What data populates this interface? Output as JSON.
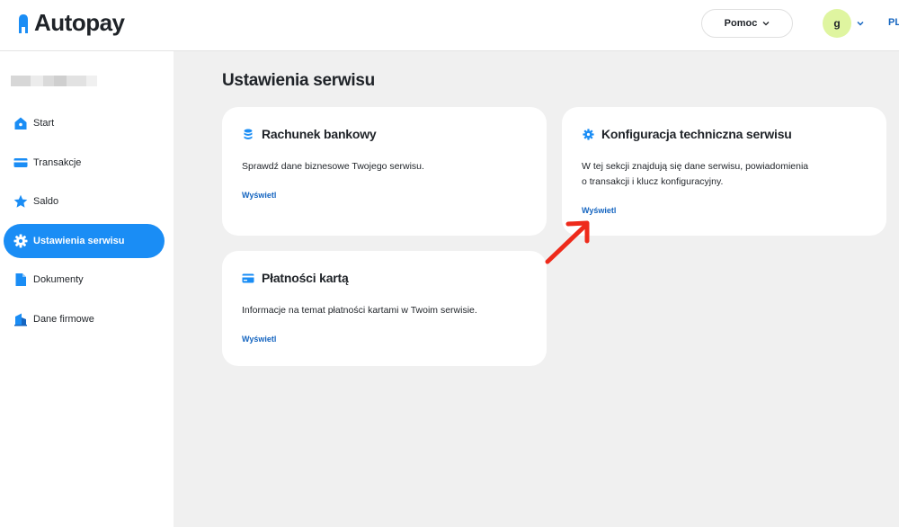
{
  "header": {
    "logo_text": "Autopay",
    "help_label": "Pomoc",
    "avatar_initial": "g",
    "language": "PL"
  },
  "sidebar": {
    "items": [
      {
        "label": "Start",
        "icon": "home-icon"
      },
      {
        "label": "Transakcje",
        "icon": "card-icon"
      },
      {
        "label": "Saldo",
        "icon": "star-icon"
      },
      {
        "label": "Ustawienia serwisu",
        "icon": "gear-icon",
        "active": true
      },
      {
        "label": "Dokumenty",
        "icon": "document-icon"
      },
      {
        "label": "Dane firmowe",
        "icon": "building-icon"
      }
    ]
  },
  "main": {
    "title": "Ustawienia serwisu",
    "cards": [
      {
        "title": "Rachunek bankowy",
        "icon": "coins-icon",
        "description": "Sprawdź dane biznesowe Twojego serwisu.",
        "link": "Wyświetl"
      },
      {
        "title": "Konfiguracja techniczna serwisu",
        "icon": "gear-icon",
        "description_line1": "W tej sekcji znajdują się dane serwisu, powiadomienia",
        "description_line2": "o transakcji i klucz konfiguracyjny.",
        "link": "Wyświetl"
      },
      {
        "title": "Płatności kartą",
        "icon": "credit-card-icon",
        "description": "Informacje na temat płatności kartami w Twoim serwisie.",
        "link": "Wyświetl"
      }
    ]
  },
  "colors": {
    "accent": "#1a8df5",
    "link": "#1565c0",
    "annotation_arrow": "#ee2a1b",
    "avatar_bg": "#dff5a0"
  }
}
